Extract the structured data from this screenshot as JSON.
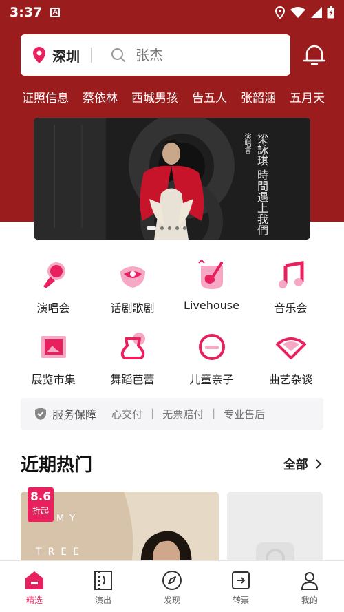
{
  "status_bar": {
    "time": "3:37",
    "notification_icon": "A"
  },
  "search": {
    "city": "深圳",
    "placeholder": "张杰"
  },
  "hot_tags": [
    "证照信息",
    "蔡依林",
    "西城男孩",
    "告五人",
    "张韶涵",
    "五月天"
  ],
  "banner": {
    "title_lines": [
      "梁詠琪",
      "時間遇上我們",
      "演唱會"
    ],
    "slide_count": 5,
    "active_slide": 1
  },
  "categories": [
    {
      "label": "演唱会",
      "icon": "microphone-icon"
    },
    {
      "label": "话剧歌剧",
      "icon": "theater-mask-icon"
    },
    {
      "label": "Livehouse",
      "icon": "guitar-icon"
    },
    {
      "label": "音乐会",
      "icon": "music-note-icon"
    },
    {
      "label": "展览市集",
      "icon": "picture-frame-icon"
    },
    {
      "label": "舞蹈芭蕾",
      "icon": "ballet-skirt-icon"
    },
    {
      "label": "儿童亲子",
      "icon": "kid-icon"
    },
    {
      "label": "曲艺杂谈",
      "icon": "fan-icon"
    }
  ],
  "service": {
    "title": "服务保障",
    "items": [
      "心交付",
      "无票赔付",
      "专业售后"
    ]
  },
  "section": {
    "title": "近期热门",
    "see_all": "全部"
  },
  "cards": [
    {
      "badge_value": "8.6",
      "badge_suffix": "折起",
      "art_text": [
        "MY",
        "TREE"
      ]
    }
  ],
  "tabs": [
    {
      "label": "精选",
      "icon": "home-icon",
      "active": true
    },
    {
      "label": "演出",
      "icon": "ticket-icon",
      "active": false
    },
    {
      "label": "发现",
      "icon": "compass-icon",
      "active": false
    },
    {
      "label": "转票",
      "icon": "transfer-icon",
      "active": false
    },
    {
      "label": "我的",
      "icon": "user-icon",
      "active": false
    }
  ],
  "colors": {
    "brand": "#e8215e",
    "header_bg": "#9b1c1c"
  }
}
